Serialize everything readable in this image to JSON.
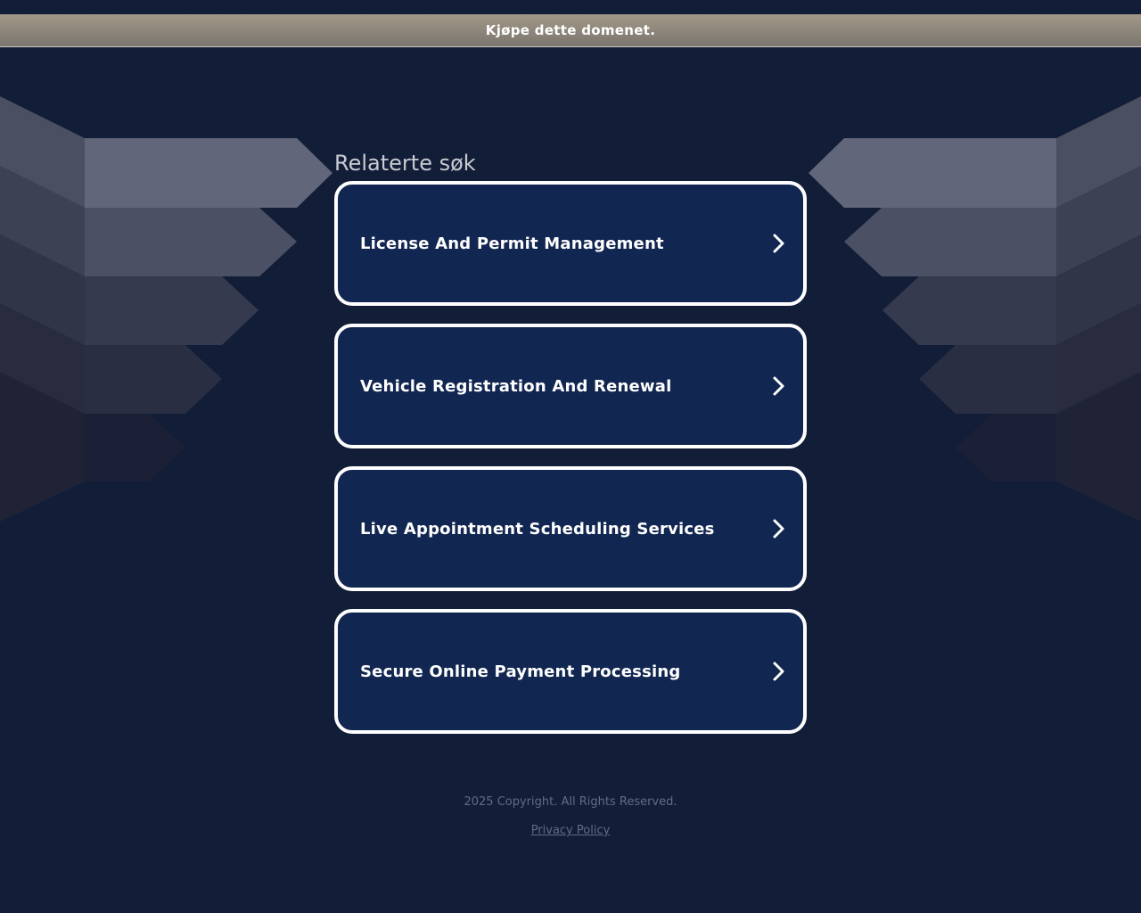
{
  "banner": {
    "buy_domain_label": "Kjøpe dette domenet."
  },
  "main": {
    "heading": "Relaterte søk",
    "links": [
      {
        "label": "License And Permit Management"
      },
      {
        "label": "Vehicle Registration And Renewal"
      },
      {
        "label": "Live Appointment Scheduling Services"
      },
      {
        "label": "Secure Online Payment Processing"
      }
    ]
  },
  "footer": {
    "copyright": "2025 Copyright. All Rights Reserved.",
    "privacy_label": "Privacy Policy"
  },
  "colors": {
    "background": "#121d38",
    "card_background": "#112650",
    "card_border": "#ffffff",
    "banner_top": "#a29888",
    "banner_bottom": "#7a756e"
  },
  "icons": {
    "card_arrow": "chevron-right-icon"
  }
}
